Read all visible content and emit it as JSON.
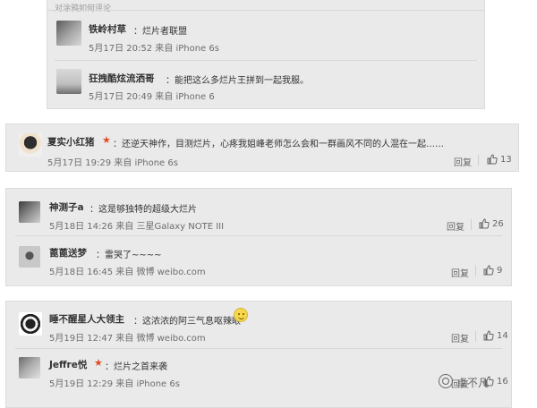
{
  "top_cut_text": "对涂鸦如何评论",
  "card1": {
    "comments": [
      {
        "name": "铁岭村草",
        "text": "：烂片者联盟",
        "meta": "5月17日 20:52 来自 iPhone 6s",
        "avatar": "avatar-landscape"
      },
      {
        "name": "狂拽酷炫流洒哥",
        "text": "：能把这么多烂片王拼到一起我服。",
        "meta": "5月17日 20:49 来自 iPhone 6",
        "avatar": "avatar-beach"
      }
    ]
  },
  "card2": {
    "comment": {
      "name": "夏实小红猪",
      "star": "★",
      "text": "：还逆天神作，目测烂片，心疼我姐峰老师怎么会和一群画风不同的人混在一起……",
      "meta": "5月17日 19:29 来自 iPhone 6s",
      "reply": "回复",
      "likes": "13"
    }
  },
  "card3": {
    "comments": [
      {
        "name": "神测子a",
        "text": "：这是够独特的超级大烂片",
        "meta": "5月18日 14:26 来自 三星Galaxy NOTE III",
        "reply": "回复",
        "likes": "26"
      },
      {
        "name": "蓖蓖送梦",
        "text": "：雷哭了~~~~",
        "meta": "5月18日 16:45 来自 微博 weibo.com",
        "reply": "回复",
        "likes": "9"
      }
    ]
  },
  "card4": {
    "comments": [
      {
        "name": "睡不醒星人大领主",
        "text": "：这浓浓的阿三气息呕辣眼",
        "meta": "5月19日 12:47 来自 微博 weibo.com",
        "reply": "回复",
        "likes": "14"
      },
      {
        "name": "Jeffre悦",
        "star": "★",
        "text": "：烂片之首来袭",
        "meta": "5月19日 12:29 来自 iPhone 6s",
        "reply": "回复",
        "likes": "16"
      }
    ]
  },
  "watermark": "卓不凡"
}
